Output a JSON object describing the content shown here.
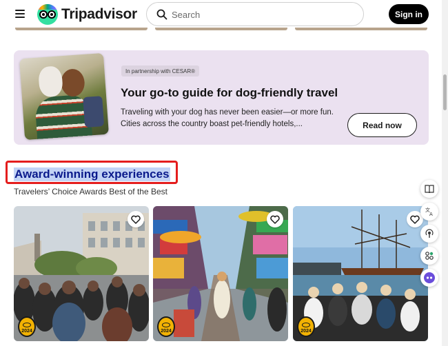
{
  "header": {
    "brand": "Tripadvisor",
    "search_placeholder": "Search",
    "signin_label": "Sign in"
  },
  "promo": {
    "partner": "In partnership with CESAR®",
    "title": "Your go-to guide for dog-friendly travel",
    "description": "Traveling with your dog has never been easier—or more fun. Cities across the country boast pet-friendly hotels,...",
    "cta": "Read now"
  },
  "section": {
    "title": "Award-winning experiences",
    "subtitle": "Travelers’ Choice Awards Best of the Best"
  },
  "cards": [
    {
      "badge_year": "2024",
      "scene": "old-town-crowd"
    },
    {
      "badge_year": "2024",
      "scene": "market-street"
    },
    {
      "badge_year": "2024",
      "scene": "canal-boat-tour"
    }
  ],
  "colors": {
    "brand_green": "#34e0a1",
    "promo_bg": "#ebe1f0",
    "highlight_border": "#e41d1d",
    "badge_yellow": "#f2b203"
  }
}
